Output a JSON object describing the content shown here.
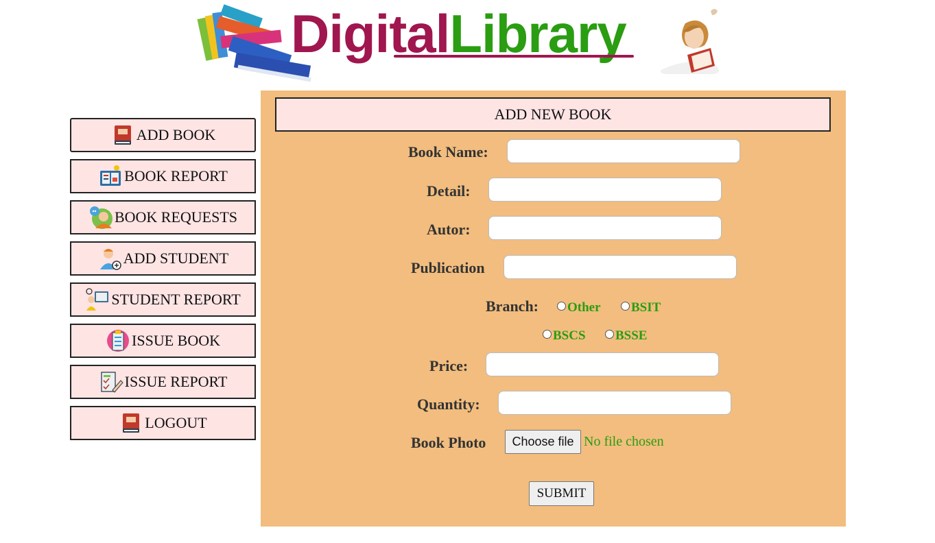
{
  "header": {
    "logo_part1": "Digital",
    "logo_part2": "Library"
  },
  "sidebar": {
    "items": [
      {
        "label": "ADD BOOK",
        "icon": "book-icon"
      },
      {
        "label": "BOOK REPORT",
        "icon": "report-icon"
      },
      {
        "label": "BOOK REQUESTS",
        "icon": "chat-person-icon"
      },
      {
        "label": "ADD STUDENT",
        "icon": "add-student-icon"
      },
      {
        "label": "STUDENT REPORT",
        "icon": "student-report-icon"
      },
      {
        "label": "ISSUE BOOK",
        "icon": "clipboard-icon"
      },
      {
        "label": "ISSUE REPORT",
        "icon": "issue-report-icon"
      },
      {
        "label": "LOGOUT",
        "icon": "book-icon"
      }
    ]
  },
  "form": {
    "title": "ADD NEW BOOK",
    "book_name_label": "Book Name:",
    "detail_label": "Detail:",
    "author_label": "Autor:",
    "publication_label": "Publication",
    "branch_label": "Branch:",
    "branch_options": [
      "Other",
      "BSIT",
      "BSCS",
      "BSSE"
    ],
    "price_label": "Price:",
    "quantity_label": "Quantity:",
    "photo_label": "Book Photo",
    "file_button": "Choose file",
    "file_status": "No file chosen",
    "submit_label": "SUBMIT"
  },
  "colors": {
    "panel_bg": "#f2bd7e",
    "button_bg": "#ffe4e4",
    "accent_green": "#2a9d12",
    "accent_magenta": "#a0164e"
  }
}
